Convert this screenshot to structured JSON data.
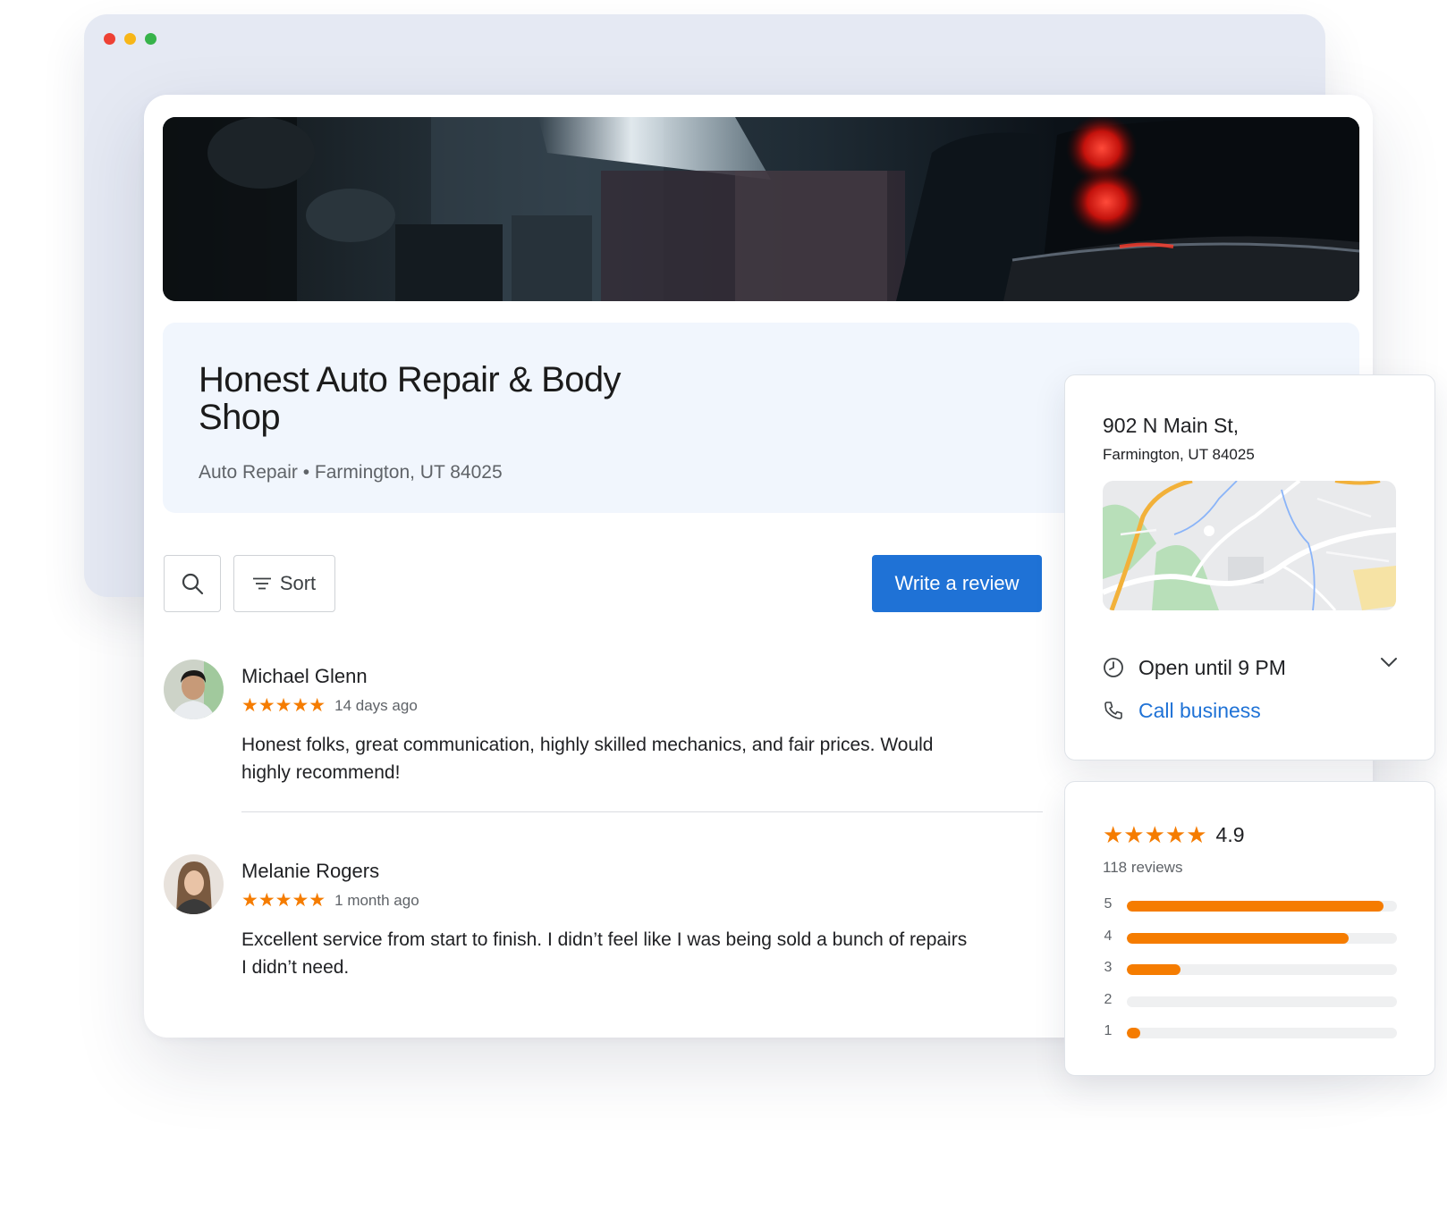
{
  "window": {
    "dots": [
      "red",
      "yellow",
      "green"
    ]
  },
  "business": {
    "name": "Honest Auto Repair & Body Shop",
    "subtitle": "Auto Repair • Farmington, UT 84025"
  },
  "toolbar": {
    "search_icon": "search-icon",
    "sort_label": "Sort",
    "write_review_label": "Write a review"
  },
  "reviews": [
    {
      "name": "Michael Glenn",
      "stars": "★★★★★",
      "rating": 5,
      "date": "14 days ago",
      "text": "Honest folks, great communication, highly skilled mechanics, and fair prices. Would highly recommend!"
    },
    {
      "name": "Melanie Rogers",
      "stars": "★★★★★",
      "rating": 5,
      "date": "1 month ago",
      "text": "Excellent service from start to finish. I didn’t feel like I was being sold a bunch of repairs I didn’t need."
    }
  ],
  "info": {
    "address_line1": "902 N Main St,",
    "address_line2": "Farmington, UT 84025",
    "hours": "Open until 9 PM",
    "call": "Call business"
  },
  "rating_summary": {
    "stars": "★★★★★",
    "value": "4.9",
    "count": "118 reviews",
    "distribution": [
      {
        "label": "5",
        "fraction": 0.95
      },
      {
        "label": "4",
        "fraction": 0.82
      },
      {
        "label": "3",
        "fraction": 0.2
      },
      {
        "label": "2",
        "fraction": 0.0
      },
      {
        "label": "1",
        "fraction": 0.05
      }
    ]
  },
  "colors": {
    "accent_blue": "#1f72d6",
    "star_orange": "#f57c00",
    "panel_bg": "#f1f6fd",
    "window_bg": "#e5e9f3"
  }
}
